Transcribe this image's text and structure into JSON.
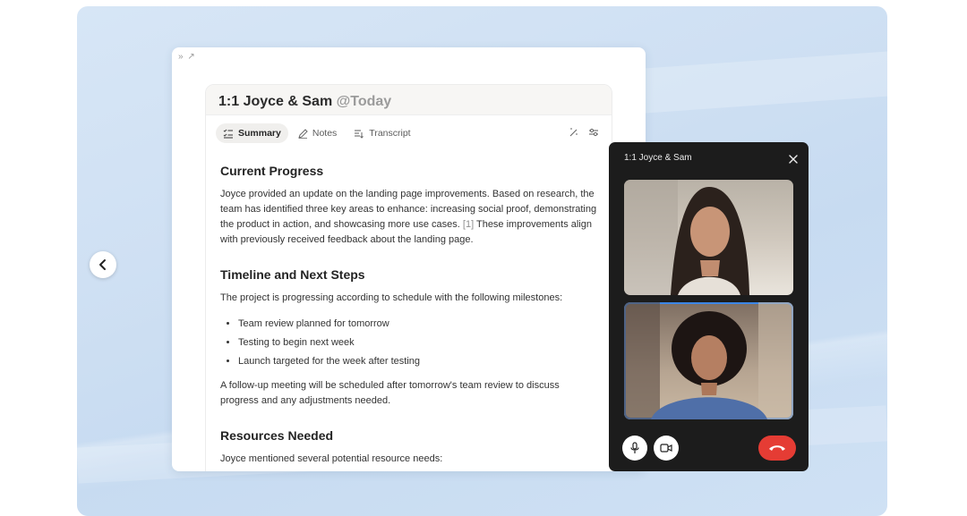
{
  "note": {
    "title": "1:1 Joyce & Sam",
    "date_tag": "@Today",
    "tabs": [
      {
        "label": "Summary",
        "icon": "summary-list-icon"
      },
      {
        "label": "Notes",
        "icon": "pencil-icon"
      },
      {
        "label": "Transcript",
        "icon": "transcript-icon"
      }
    ],
    "sections": {
      "progress": {
        "heading": "Current Progress",
        "body": "Joyce provided an update on the landing page improvements. Based on research, the team has identified three key areas to enhance: increasing social proof, demonstrating the product in action, and showcasing more use cases.",
        "cite": "[1]",
        "body_after": " These improvements align with previously received feedback about the landing page."
      },
      "timeline": {
        "heading": "Timeline and Next Steps",
        "intro": "The project is progressing according to schedule with the following milestones:",
        "items": [
          "Team review planned for tomorrow",
          "Testing to begin next week",
          "Launch targeted for the week after testing"
        ],
        "followup": "A follow-up meeting will be scheduled after tomorrow's team review to discuss progress and any adjustments needed."
      },
      "resources": {
        "heading": "Resources Needed",
        "body": "Joyce mentioned several potential resource needs:"
      }
    }
  },
  "call": {
    "title": "1:1 Joyce & Sam"
  },
  "colors": {
    "accent_blue": "#3c86e6",
    "hangup_red": "#e53c34",
    "panel_bg": "#1c1c1c"
  }
}
